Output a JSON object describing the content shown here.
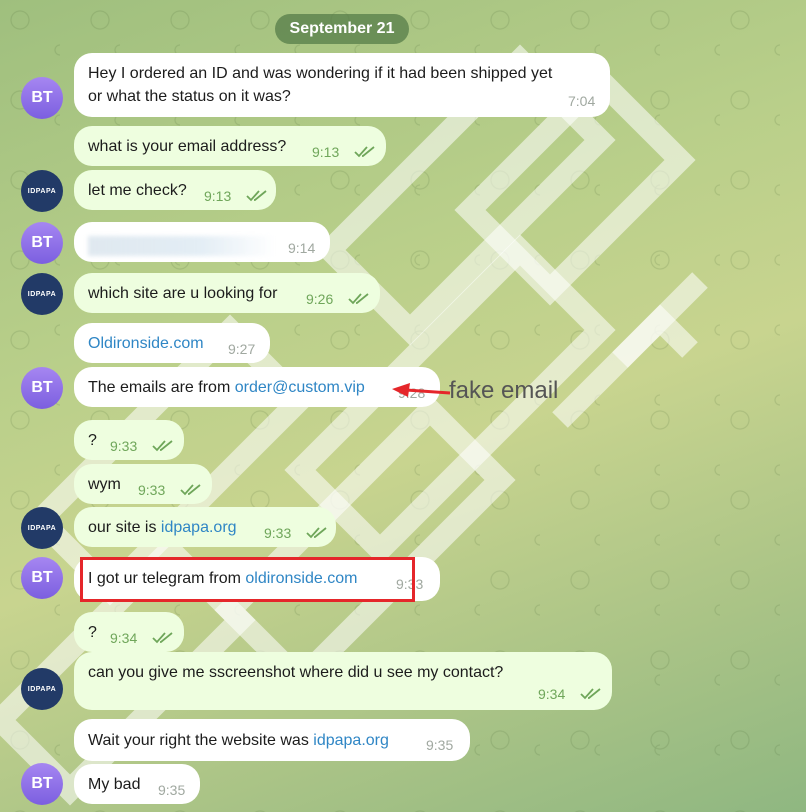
{
  "date_label": "September 21",
  "avatars": {
    "customer_initials": "BT",
    "seller_logo_text": "IDPAPA"
  },
  "messages": [
    {
      "text_line1": "Hey I ordered an ID and was wondering if it had been shipped yet",
      "text_line2": "or what the status on it was?",
      "time": "7:04"
    },
    {
      "text": "what is your email address?",
      "time": "9:13"
    },
    {
      "text": "let me check?",
      "time": "9:13"
    },
    {
      "text": "",
      "time": "9:14"
    },
    {
      "text": "which site are u looking for",
      "time": "9:26"
    },
    {
      "text": "Oldironside.com",
      "time": "9:27"
    },
    {
      "text_prefix": "The emails are from ",
      "link": "order@custom.vip",
      "time": "9:28"
    },
    {
      "text": "?",
      "time": "9:33"
    },
    {
      "text": "wym",
      "time": "9:33"
    },
    {
      "text_prefix": "our site is ",
      "link": "idpapa.org",
      "time": "9:33"
    },
    {
      "text_prefix": "I got ur telegram from ",
      "link": "oldironside.com",
      "time": "9:33"
    },
    {
      "text": "?",
      "time": "9:34"
    },
    {
      "text": "can you give me sscreenshot where did u see my contact?",
      "time": "9:34"
    },
    {
      "text_prefix": "Wait your right the website was ",
      "link": "idpapa.org",
      "time": "9:35"
    },
    {
      "text": "My bad",
      "time": "9:35"
    }
  ],
  "annotation": {
    "label": "fake email",
    "arrow_color": "#e5262a",
    "highlight_color": "#e5262a"
  },
  "colors": {
    "link": "#2f86c5",
    "outgoing_bubble": "#eefedf",
    "incoming_bubble": "#ffffff",
    "date_pill": "#567c48"
  }
}
